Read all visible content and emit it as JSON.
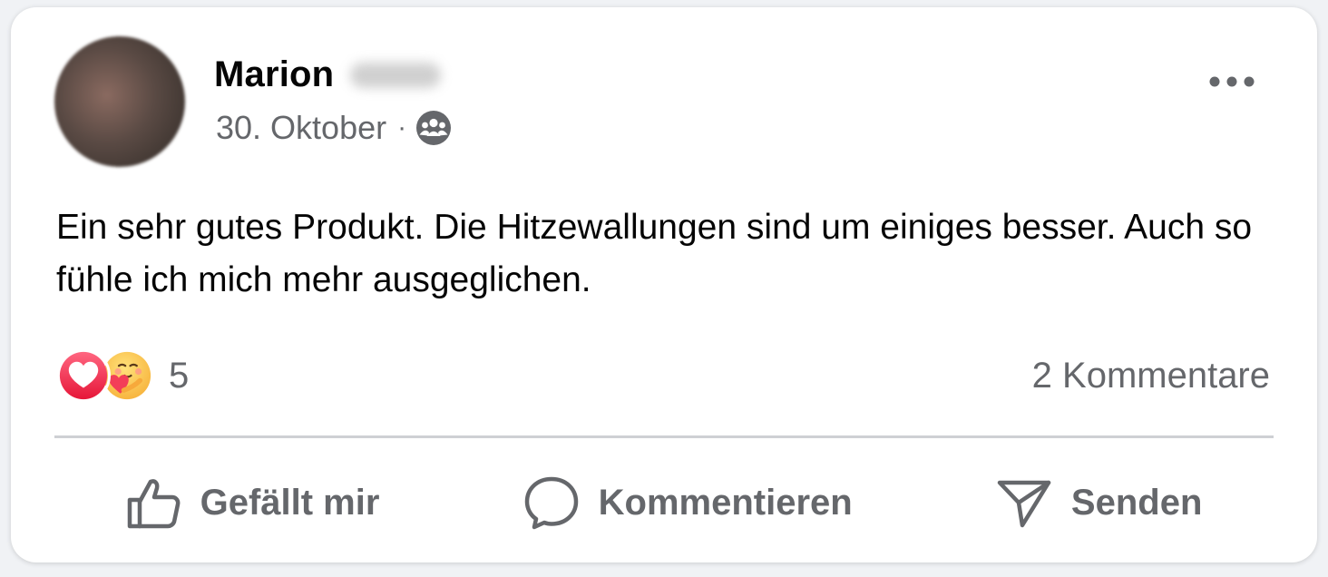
{
  "post": {
    "author_name": "Marion",
    "date": "30. Oktober",
    "separator": "·",
    "audience_icon": "group-icon",
    "text": "Ein sehr gutes Produkt. Die Hitzewallungen sind um einiges besser. Auch so fühle ich mich mehr ausgeglichen."
  },
  "reactions": {
    "icons": [
      "love-reaction-icon",
      "care-reaction-icon"
    ],
    "count": "5"
  },
  "comments": {
    "label": "2 Kommentare"
  },
  "actions": {
    "like_label": "Gefällt mir",
    "comment_label": "Kommentieren",
    "share_label": "Senden"
  },
  "colors": {
    "text_primary": "#050505",
    "text_secondary": "#65676b",
    "divider": "#ced0d4",
    "love_red": "#f33e58",
    "card_background": "#ffffff"
  }
}
